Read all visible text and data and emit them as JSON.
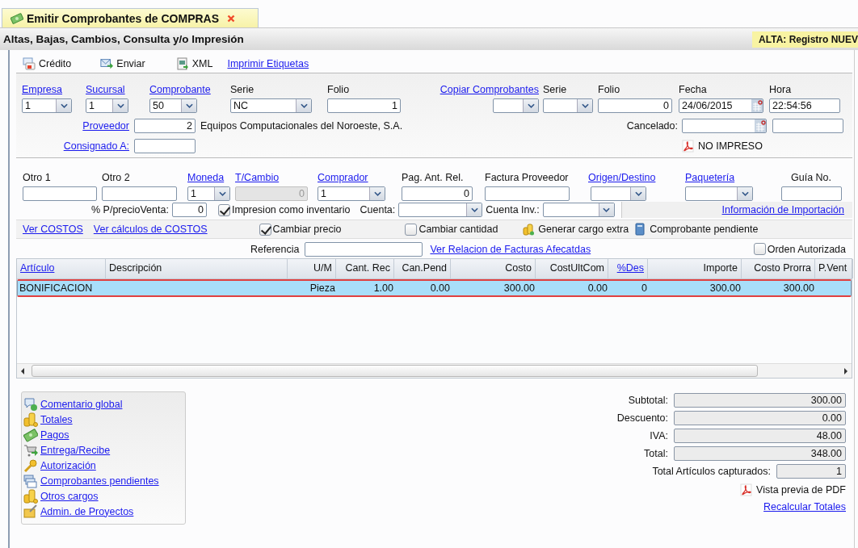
{
  "tab": {
    "title": "Emitir Comprobantes de COMPRAS"
  },
  "header": {
    "title": "Altas, Bajas, Cambios, Consulta y/o Impresión",
    "status": "ALTA: Registro NUEV"
  },
  "toolbar": [
    {
      "kind": "credit",
      "label": "Crédito"
    },
    {
      "kind": "send",
      "label": "Enviar"
    },
    {
      "kind": "xml",
      "label": "XML"
    },
    {
      "kind": "link",
      "label": "Imprimir Etiquetas"
    }
  ],
  "document": {
    "fields": [
      {
        "label": "Empresa",
        "link": true,
        "kind": "select",
        "value": "1"
      },
      {
        "label": "Sucursal",
        "link": true,
        "kind": "select",
        "value": "1"
      },
      {
        "label": "Comprobante",
        "link": true,
        "kind": "select",
        "value": "50"
      },
      {
        "label": "Serie",
        "link": false,
        "kind": "select",
        "value": "NC"
      },
      {
        "label": "Folio",
        "link": false,
        "kind": "number",
        "value": "1"
      },
      {
        "label": "Copiar Comprobantes",
        "link": true,
        "kind": "select"
      },
      {
        "label": "Serie",
        "link": false,
        "kind": "select"
      },
      {
        "label": "Folio",
        "link": false,
        "kind": "number",
        "value": "0"
      },
      {
        "label": "Fecha",
        "link": false,
        "kind": "date",
        "value": "24/06/2015"
      },
      {
        "label": "Hora",
        "link": false,
        "kind": "text",
        "value": "22:54:56"
      }
    ],
    "proveedor": {
      "label": "Proveedor",
      "value": "2",
      "name": "Equipos Computacionales del Noroeste, S.A."
    },
    "cancelado": {
      "label": "Cancelado:"
    },
    "consignado": {
      "label": "Consignado A:"
    },
    "print_status": "NO IMPRESO"
  },
  "details": {
    "fields": [
      {
        "label": "Otro 1",
        "link": false,
        "kind": "text"
      },
      {
        "label": "Otro 2",
        "link": false,
        "kind": "text"
      },
      {
        "label": "Moneda",
        "link": true,
        "kind": "select",
        "value": "1"
      },
      {
        "label": "T/Cambio",
        "link": true,
        "kind": "number",
        "value": "0",
        "disabled": true
      },
      {
        "label": "Comprador",
        "link": true,
        "kind": "select",
        "value": "1"
      },
      {
        "label": "Pag. Ant. Rel.",
        "link": false,
        "kind": "number",
        "value": "0"
      },
      {
        "label": "Factura Proveedor",
        "link": false,
        "kind": "text"
      },
      {
        "label": "Origen/Destino",
        "link": true,
        "kind": "select"
      },
      {
        "label": "Paquetería",
        "link": true,
        "kind": "select"
      },
      {
        "label": "Guía No.",
        "link": false,
        "kind": "text"
      }
    ],
    "precio_venta": {
      "label": "% P/precioVenta:",
      "value": "0"
    },
    "impresion": {
      "label": "Impresion como inventario",
      "checked": true
    },
    "cuenta": {
      "label": "Cuenta:"
    },
    "cuenta_inv": {
      "label": "Cuenta Inv.:"
    },
    "importacion": "Información de Importación"
  },
  "costs_bar": {
    "links": [
      "Ver COSTOS",
      "Ver cálculos de COSTOS"
    ],
    "checks": [
      {
        "label": "Cambiar precio",
        "checked": true
      },
      {
        "label": "Cambiar cantidad",
        "checked": false
      }
    ],
    "actions": [
      {
        "kind": "coins",
        "label": "Generar cargo extra"
      },
      {
        "kind": "book",
        "label": "Comprobante pendiente"
      }
    ]
  },
  "reference": {
    "label": "Referencia",
    "link": "Ver Relacion de Facturas Afecatdas",
    "orden": {
      "label": "Orden Autorizada",
      "checked": false
    }
  },
  "table": {
    "columns": [
      {
        "label": "Artículo",
        "link": true
      },
      {
        "label": "Descripción",
        "link": false
      },
      {
        "label": "U/M",
        "link": false
      },
      {
        "label": "Cant. Rec",
        "link": false
      },
      {
        "label": "Can.Pend",
        "link": false
      },
      {
        "label": "Costo",
        "link": false
      },
      {
        "label": "CostUltCom",
        "link": false
      },
      {
        "label": "%Des",
        "link": true
      },
      {
        "label": "Importe",
        "link": false
      },
      {
        "label": "Costo Prorra",
        "link": false
      },
      {
        "label": "P.Vent",
        "link": false
      }
    ],
    "rows": [
      {
        "selected": true,
        "cells": [
          "BONIFICACION",
          "",
          "Pieza",
          "1.00",
          "0.00",
          "300.00",
          "0.00",
          "0",
          "300.00",
          "300.00",
          ""
        ]
      }
    ]
  },
  "actions": [
    {
      "kind": "comment",
      "label": "Comentario global"
    },
    {
      "kind": "coins",
      "label": "Totales"
    },
    {
      "kind": "money",
      "label": "Pagos"
    },
    {
      "kind": "cart",
      "label": "Entrega/Recibe"
    },
    {
      "kind": "key",
      "label": "Autorización"
    },
    {
      "kind": "docs",
      "label": "Comprobantes pendientes"
    },
    {
      "kind": "coins",
      "label": "Otros cargos"
    },
    {
      "kind": "folder",
      "label": "Admin. de Proyectos"
    }
  ],
  "totals": [
    {
      "label": "Subtotal:",
      "value": "300.00"
    },
    {
      "label": "Descuento:",
      "value": "0.00"
    },
    {
      "label": "IVA:",
      "value": "48.00"
    },
    {
      "label": "Total:",
      "value": "348.00"
    }
  ],
  "items_count": {
    "label": "Total Artículos capturados:",
    "value": "1"
  },
  "pdf_preview": "Vista previa de PDF",
  "recalc": "Recalcular Totales"
}
